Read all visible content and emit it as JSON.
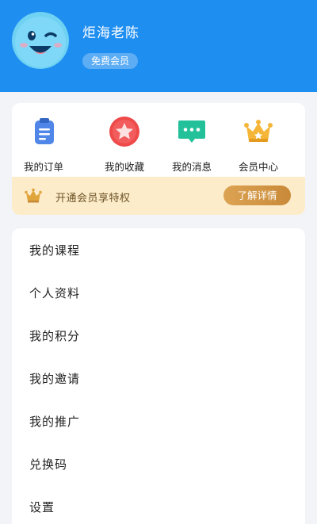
{
  "profile": {
    "name": "炬海老陈",
    "badge": "免费会员",
    "avatar_icon": "smiley-face-icon"
  },
  "quick_actions": [
    {
      "label": "我的订单",
      "icon": "order-clipboard-icon",
      "color": "#4f86e8"
    },
    {
      "label": "我的收藏",
      "icon": "star-favorite-icon",
      "color": "#ee4a4a"
    },
    {
      "label": "我的消息",
      "icon": "message-bubble-icon",
      "color": "#22c19a"
    },
    {
      "label": "会员中心",
      "icon": "crown-icon",
      "color": "#f5b638"
    }
  ],
  "vip_banner": {
    "text": "开通会员享特权",
    "button": "了解详情",
    "icon": "crown-icon"
  },
  "menu": [
    {
      "label": "我的课程"
    },
    {
      "label": "个人资料"
    },
    {
      "label": "我的积分"
    },
    {
      "label": "我的邀请"
    },
    {
      "label": "我的推广"
    },
    {
      "label": "兑换码"
    },
    {
      "label": "设置"
    }
  ],
  "colors": {
    "header_bg": "#1f8ef1",
    "page_bg": "#f3f4f7",
    "vip_bg": "#fcecc9",
    "vip_button": "#d09440"
  }
}
